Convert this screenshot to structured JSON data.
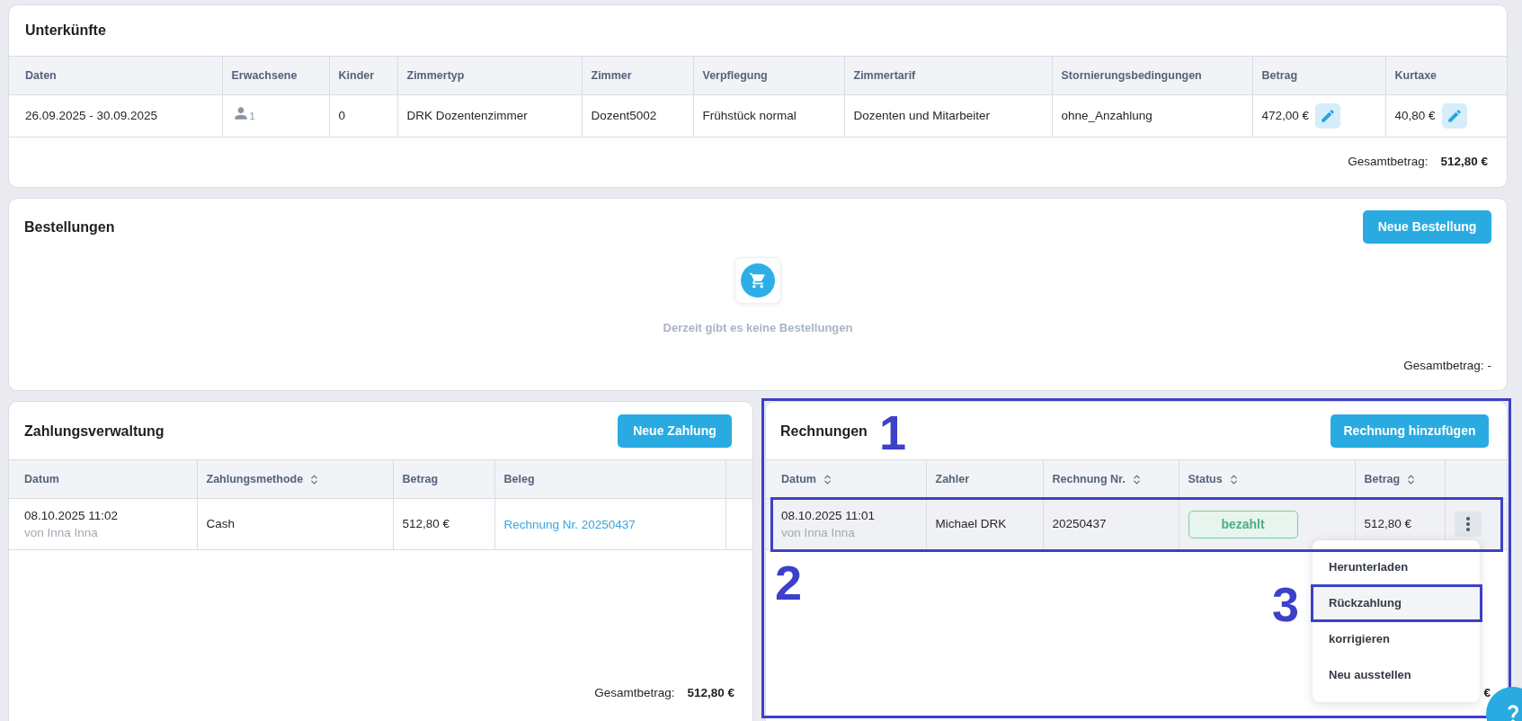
{
  "accommodations": {
    "title": "Unterkünfte",
    "columns": [
      "Daten",
      "Erwachsene",
      "Kinder",
      "Zimmertyp",
      "Zimmer",
      "Verpflegung",
      "Zimmertarif",
      "Stornierungsbedingungen",
      "Betrag",
      "Kurtaxe"
    ],
    "rows": [
      {
        "dates": "26.09.2025 - 30.09.2025",
        "adults": "1",
        "children": "0",
        "room_type": "DRK Dozentenzimmer",
        "room": "Dozent5002",
        "board": "Frühstück normal",
        "rate": "Dozenten und Mitarbeiter",
        "cancellation": "ohne_Anzahlung",
        "amount": "472,00 €",
        "tourist_tax": "40,80 €"
      }
    ],
    "total_label": "Gesamtbetrag:",
    "total_value": "512,80 €"
  },
  "orders": {
    "title": "Bestellungen",
    "button": "Neue Bestellung",
    "empty_message": "Derzeit gibt es keine Bestellungen",
    "total_label": "Gesamtbetrag:",
    "total_value": "-"
  },
  "payments": {
    "title": "Zahlungsverwaltung",
    "button": "Neue Zahlung",
    "columns": [
      {
        "label": "Datum",
        "sortable": false
      },
      {
        "label": "Zahlungsmethode",
        "sortable": true
      },
      {
        "label": "Betrag",
        "sortable": false
      },
      {
        "label": "Beleg",
        "sortable": false
      }
    ],
    "rows": [
      {
        "date": "08.10.2025 11:02",
        "author": "von Inna Inna",
        "method": "Cash",
        "amount": "512,80 €",
        "receipt": "Rechnung Nr. 20250437"
      }
    ],
    "total_label": "Gesamtbetrag:",
    "total_value": "512,80 €"
  },
  "invoices": {
    "title": "Rechnungen",
    "button": "Rechnung hinzufügen",
    "columns": [
      {
        "label": "Datum",
        "sortable": true
      },
      {
        "label": "Zahler",
        "sortable": false
      },
      {
        "label": "Rechnung Nr.",
        "sortable": true
      },
      {
        "label": "Status",
        "sortable": true
      },
      {
        "label": "Betrag",
        "sortable": true
      }
    ],
    "rows": [
      {
        "date": "08.10.2025 11:01",
        "author": "von Inna Inna",
        "payer": "Michael DRK",
        "number": "20250437",
        "status": "bezahlt",
        "amount": "512,80 €",
        "selected": true,
        "menu_open": true
      }
    ],
    "menu": [
      {
        "label": "Herunterladen",
        "selected": false
      },
      {
        "label": "Rückzahlung",
        "selected": true
      },
      {
        "label": "korrigieren",
        "selected": false
      },
      {
        "label": "Neu ausstellen",
        "selected": false
      }
    ],
    "total_fragment": "€"
  },
  "annotations": [
    {
      "label": "1"
    },
    {
      "label": "2"
    },
    {
      "label": "3"
    }
  ]
}
